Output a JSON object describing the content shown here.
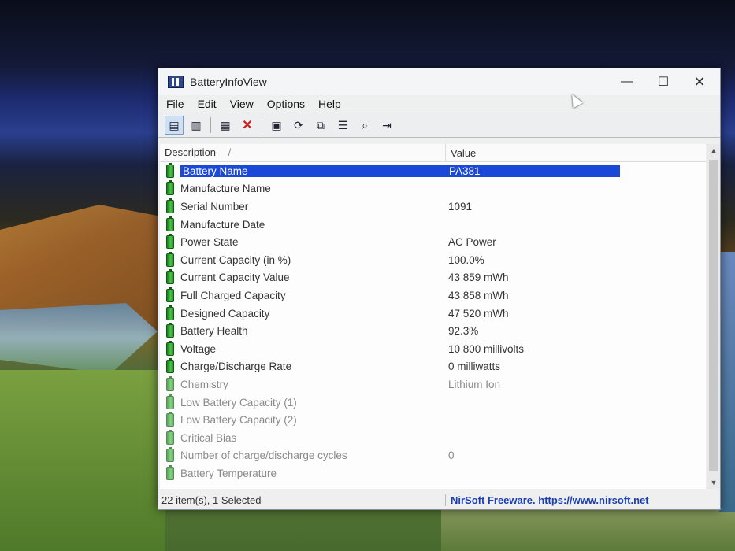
{
  "window": {
    "title": "BatteryInfoView",
    "controls": {
      "minimize": "—",
      "maximize": "☐",
      "close": "✕"
    }
  },
  "menu": [
    "File",
    "Edit",
    "View",
    "Options",
    "Help"
  ],
  "toolbar_icons": [
    "view-list-icon",
    "view-report-icon",
    "html-report-icon",
    "delete-icon",
    "save-icon",
    "refresh-icon",
    "copy-icon",
    "properties-icon",
    "find-icon",
    "exit-icon"
  ],
  "columns": {
    "description": "Description",
    "sort_indicator": "/",
    "value": "Value"
  },
  "rows": [
    {
      "description": "Battery Name",
      "value": "PA381",
      "selected": true
    },
    {
      "description": "Manufacture Name",
      "value": ""
    },
    {
      "description": "Serial Number",
      "value": "1091"
    },
    {
      "description": "Manufacture Date",
      "value": ""
    },
    {
      "description": "Power State",
      "value": "AC Power"
    },
    {
      "description": "Current Capacity (in %)",
      "value": "100.0%"
    },
    {
      "description": "Current Capacity Value",
      "value": "43 859 mWh"
    },
    {
      "description": "Full Charged Capacity",
      "value": "43 858 mWh"
    },
    {
      "description": "Designed Capacity",
      "value": "47 520 mWh"
    },
    {
      "description": "Battery Health",
      "value": "92.3%"
    },
    {
      "description": "Voltage",
      "value": "10 800 millivolts"
    },
    {
      "description": "Charge/Discharge Rate",
      "value": "0 milliwatts"
    },
    {
      "description": "Chemistry",
      "value": "Lithium Ion",
      "dim": true
    },
    {
      "description": "Low Battery Capacity (1)",
      "value": "",
      "dim": true
    },
    {
      "description": "Low Battery Capacity (2)",
      "value": "",
      "dim": true
    },
    {
      "description": "Critical Bias",
      "value": "",
      "dim": true
    },
    {
      "description": "Number of charge/discharge cycles",
      "value": "0",
      "dim": true
    },
    {
      "description": "Battery Temperature",
      "value": "",
      "dim": true
    }
  ],
  "status": {
    "items": "22 item(s), 1 Selected",
    "credit": "NirSoft Freeware. https://www.nirsoft.net"
  }
}
